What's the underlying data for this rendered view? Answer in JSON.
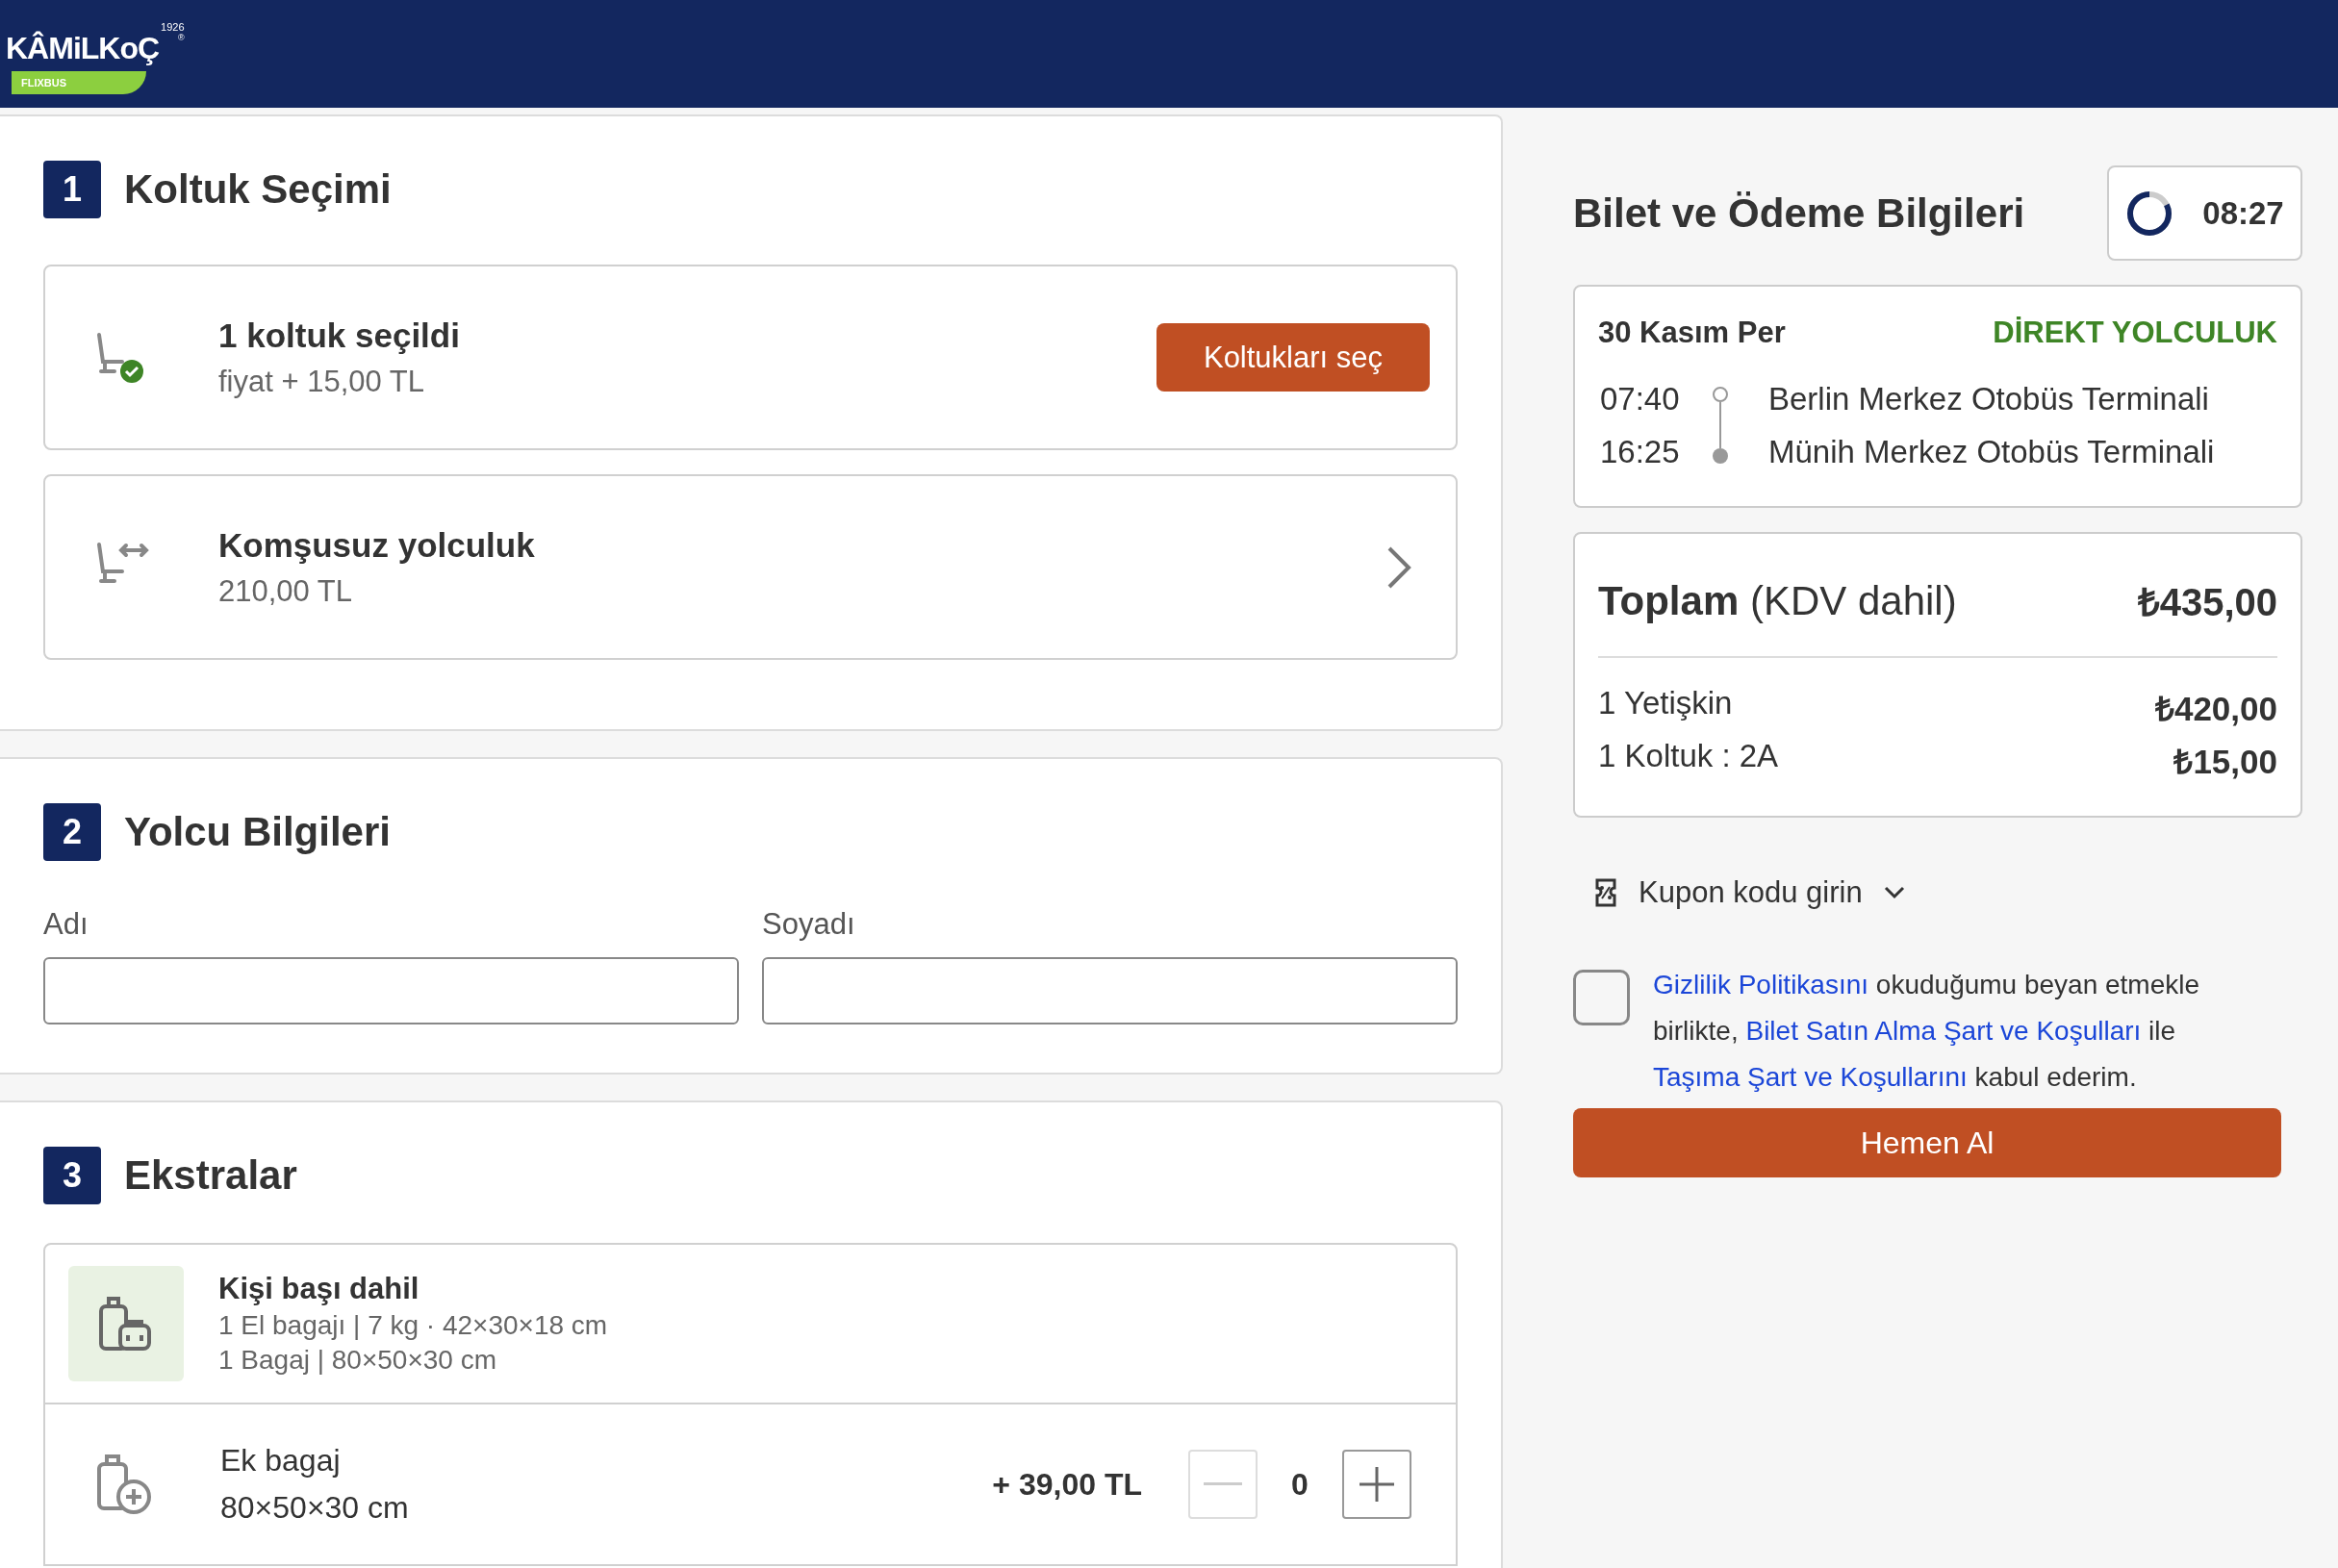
{
  "header": {
    "logo": {
      "name": "KÂMiLKoÇ",
      "year": "1926",
      "mark": "®",
      "partner": "FLIXBUS"
    }
  },
  "sections": [
    {
      "number": "1",
      "title": "Koltuk Seçimi",
      "kind": "seats",
      "options": [
        {
          "kind": "selected",
          "title": "1 koltuk seçildi",
          "subtitle": "fiyat + 15,00 TL",
          "button": "Koltukları seç"
        },
        {
          "kind": "link",
          "title": "Komşusuz yolculuk",
          "subtitle": "210,00 TL"
        }
      ]
    },
    {
      "number": "2",
      "title": "Yolcu Bilgileri",
      "kind": "form",
      "fields": [
        {
          "label": "Adı"
        },
        {
          "label": "Soyadı"
        }
      ]
    },
    {
      "number": "3",
      "title": "Ekstralar",
      "kind": "extras",
      "included": {
        "title": "Kişi başı dahil",
        "lines": [
          "1 El bagajı | 7 kg · 42×30×18 cm",
          "1 Bagaj | 80×50×30 cm"
        ]
      },
      "addons": [
        {
          "title": "Ek bagaj",
          "subtitle": "80×50×30 cm",
          "price": "+ 39,00 TL",
          "quantity": "0",
          "decrease_disabled": true
        }
      ]
    }
  ],
  "summary": {
    "title": "Bilet ve Ödeme Bilgileri",
    "timer": {
      "time": "08:27",
      "level": 0.82
    },
    "trip": {
      "date": "30 Kasım Per",
      "badge": "DİREKT YOLCULUK",
      "stops": [
        {
          "time": "07:40",
          "place": "Berlin Merkez Otobüs Terminali",
          "kind": "departure"
        },
        {
          "time": "16:25",
          "place": "Münih Merkez Otobüs Terminali",
          "kind": "arrival"
        }
      ]
    },
    "total": {
      "label": "**Toplam** (KDV dahil)",
      "amount": "₺435,00",
      "items": [
        {
          "label": "1 Yetişkin",
          "amount": "₺420,00"
        },
        {
          "label": "1 Koltuk : 2A",
          "amount": "₺15,00"
        }
      ]
    },
    "coupon": {
      "label": "Kupon kodu girin",
      "expanded": false
    },
    "consent": {
      "checked": false,
      "parts": [
        {
          "text": "Gizlilik Politikasını",
          "kind": "link"
        },
        {
          "text": " okuduğumu beyan etmekle birlikte, ",
          "kind": "text"
        },
        {
          "text": "Bilet Satın Alma Şart ve Koşulları",
          "kind": "link"
        },
        {
          "text": " ile ",
          "kind": "text"
        },
        {
          "text": "Taşıma Şart ve Koşullarını",
          "kind": "link"
        },
        {
          "text": " kabul ederim.",
          "kind": "text"
        }
      ]
    },
    "button": "Hemen Al"
  }
}
